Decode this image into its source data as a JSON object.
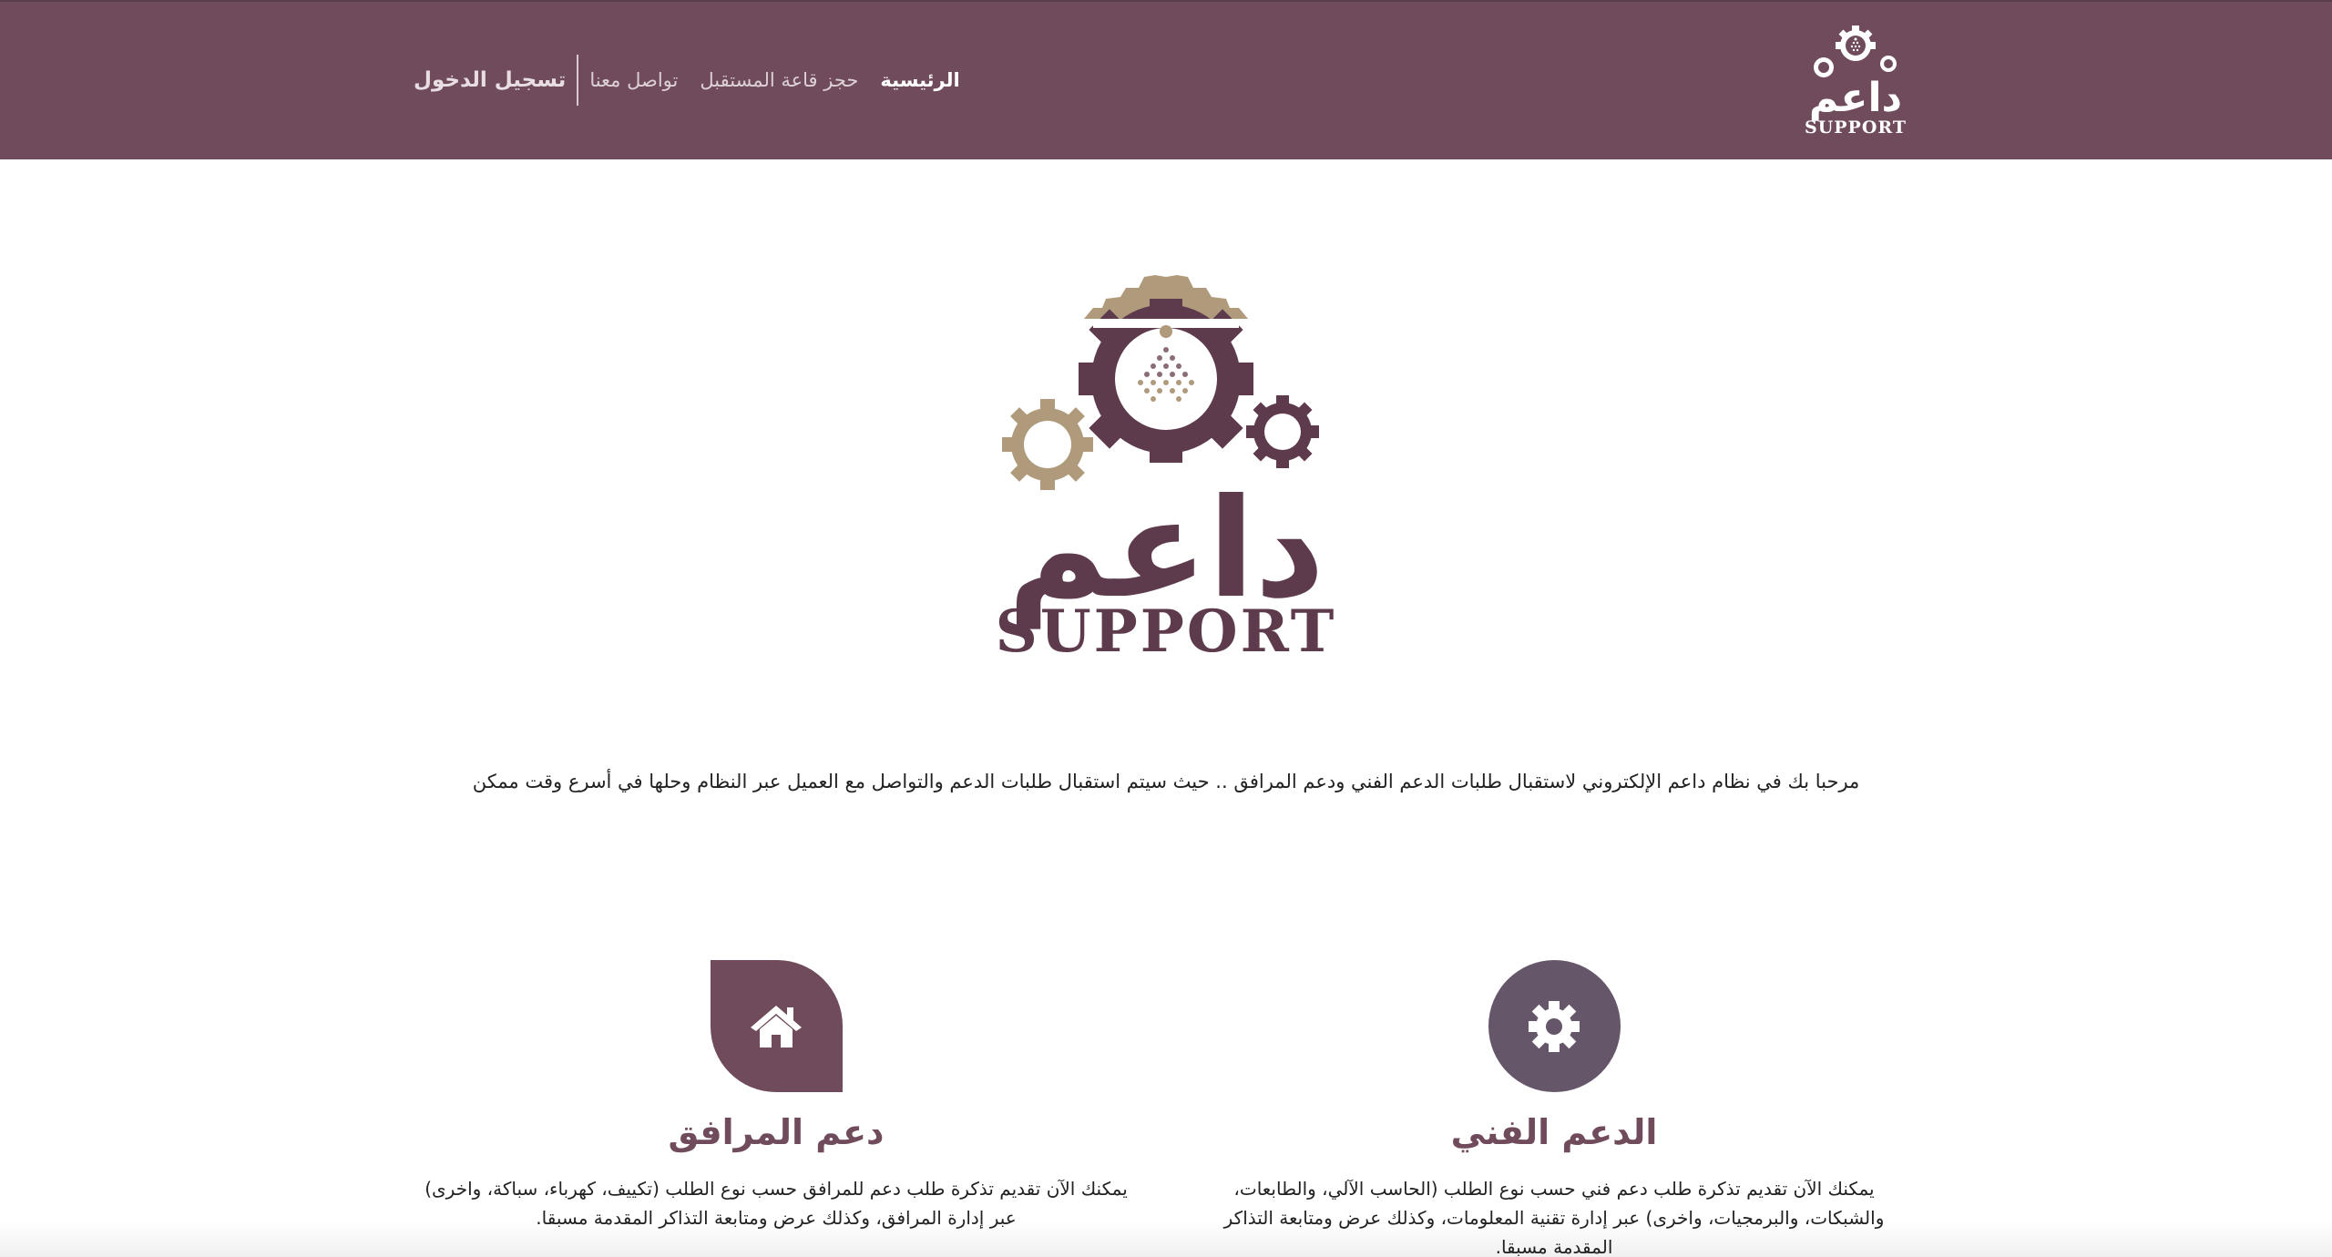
{
  "header": {
    "brand": {
      "text_ar": "داعم",
      "text_en": "SUPPORT"
    },
    "nav": [
      {
        "label": "الرئيسية"
      },
      {
        "label": "حجز قاعة المستقبل"
      },
      {
        "label": "تواصل معنا"
      }
    ],
    "login_label": "تسجيل الدخول"
  },
  "hero": {
    "logo_ar": "داعم",
    "logo_en": "SUPPORT"
  },
  "welcome_text": "مرحبا بك في نظام داعم الإلكتروني لاستقبال طلبات الدعم الفني ودعم المرافق .. حيث سيتم استقبال طلبات الدعم والتواصل مع العميل عبر النظام وحلها في أسرع وقت ممكن",
  "services": [
    {
      "title": "الدعم الفني",
      "description": "يمكنك الآن تقديم تذكرة طلب دعم فني حسب نوع الطلب (الحاسب الآلي، والطابعات، والشبكات، والبرمجيات، واخرى) عبر إدارة تقنية المعلومات، وكذلك عرض ومتابعة التذاكر المقدمة مسبقا.",
      "icon": "gear-icon"
    },
    {
      "title": "دعم المرافق",
      "description": "يمكنك الآن تقديم تذكرة طلب دعم للمرافق حسب نوع الطلب (تكييف، كهرباء، سباكة، واخرى) عبر إدارة المرافق، وكذلك عرض ومتابعة التذاكر المقدمة مسبقا.",
      "icon": "home-icon"
    }
  ],
  "colors": {
    "header_bg": "#6f4b5c",
    "brand_dark": "#5d3b4c",
    "brand_tan": "#b09a7c",
    "tech_icon_bg": "#655769"
  }
}
